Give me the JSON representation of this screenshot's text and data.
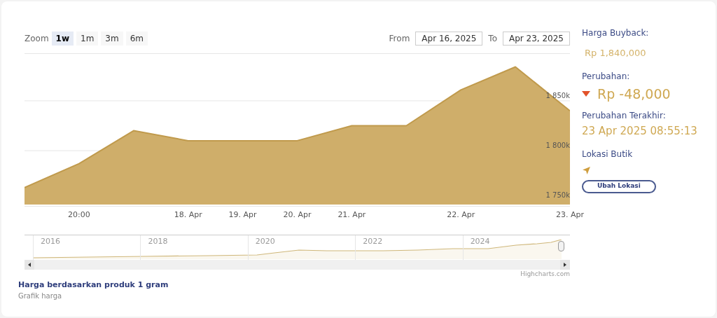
{
  "zoom": {
    "label": "Zoom",
    "buttons": [
      {
        "label": "1w",
        "selected": true
      },
      {
        "label": "1m",
        "selected": false
      },
      {
        "label": "3m",
        "selected": false
      },
      {
        "label": "6m",
        "selected": false
      }
    ]
  },
  "range": {
    "from_label": "From",
    "from": "Apr 16, 2025",
    "to_label": "To",
    "to": "Apr 23, 2025"
  },
  "chart": {
    "chart_data": {
      "type": "area",
      "categories": [
        null,
        "20:00",
        null,
        "18. Apr",
        "19. Apr",
        "20. Apr",
        "21. Apr",
        null,
        "22. Apr",
        null,
        "23. Apr"
      ],
      "series": [
        {
          "color": "#cfae6a",
          "values": [
            1763,
            1787,
            1820,
            1810,
            1810,
            1810,
            1825,
            1825,
            1861,
            1884,
            1840
          ]
        }
      ],
      "ylim": [
        1746,
        1897
      ],
      "yticks": [
        {
          "value": 1750,
          "label": "1 750k"
        },
        {
          "value": 1800,
          "label": "1 800k"
        },
        {
          "value": 1850,
          "label": "1 850k"
        }
      ]
    }
  },
  "navigator": {
    "years": [
      "2016",
      "2018",
      "2020",
      "2022",
      "2024"
    ]
  },
  "credit": "Highcharts.com",
  "caption": {
    "title": "Harga berdasarkan produk 1 gram",
    "subtitle": "Grafik harga"
  },
  "info": {
    "buyback_label": "Harga Buyback:",
    "buyback": "Rp 1,840,000",
    "change_label": "Perubahan:",
    "change": "Rp -48,000",
    "change_down": true,
    "last_label": "Perubahan Terakhir:",
    "last": "23 Apr 2025 08:55:13",
    "location_label": "Lokasi Butik",
    "location_button": "Ubah Lokasi"
  }
}
